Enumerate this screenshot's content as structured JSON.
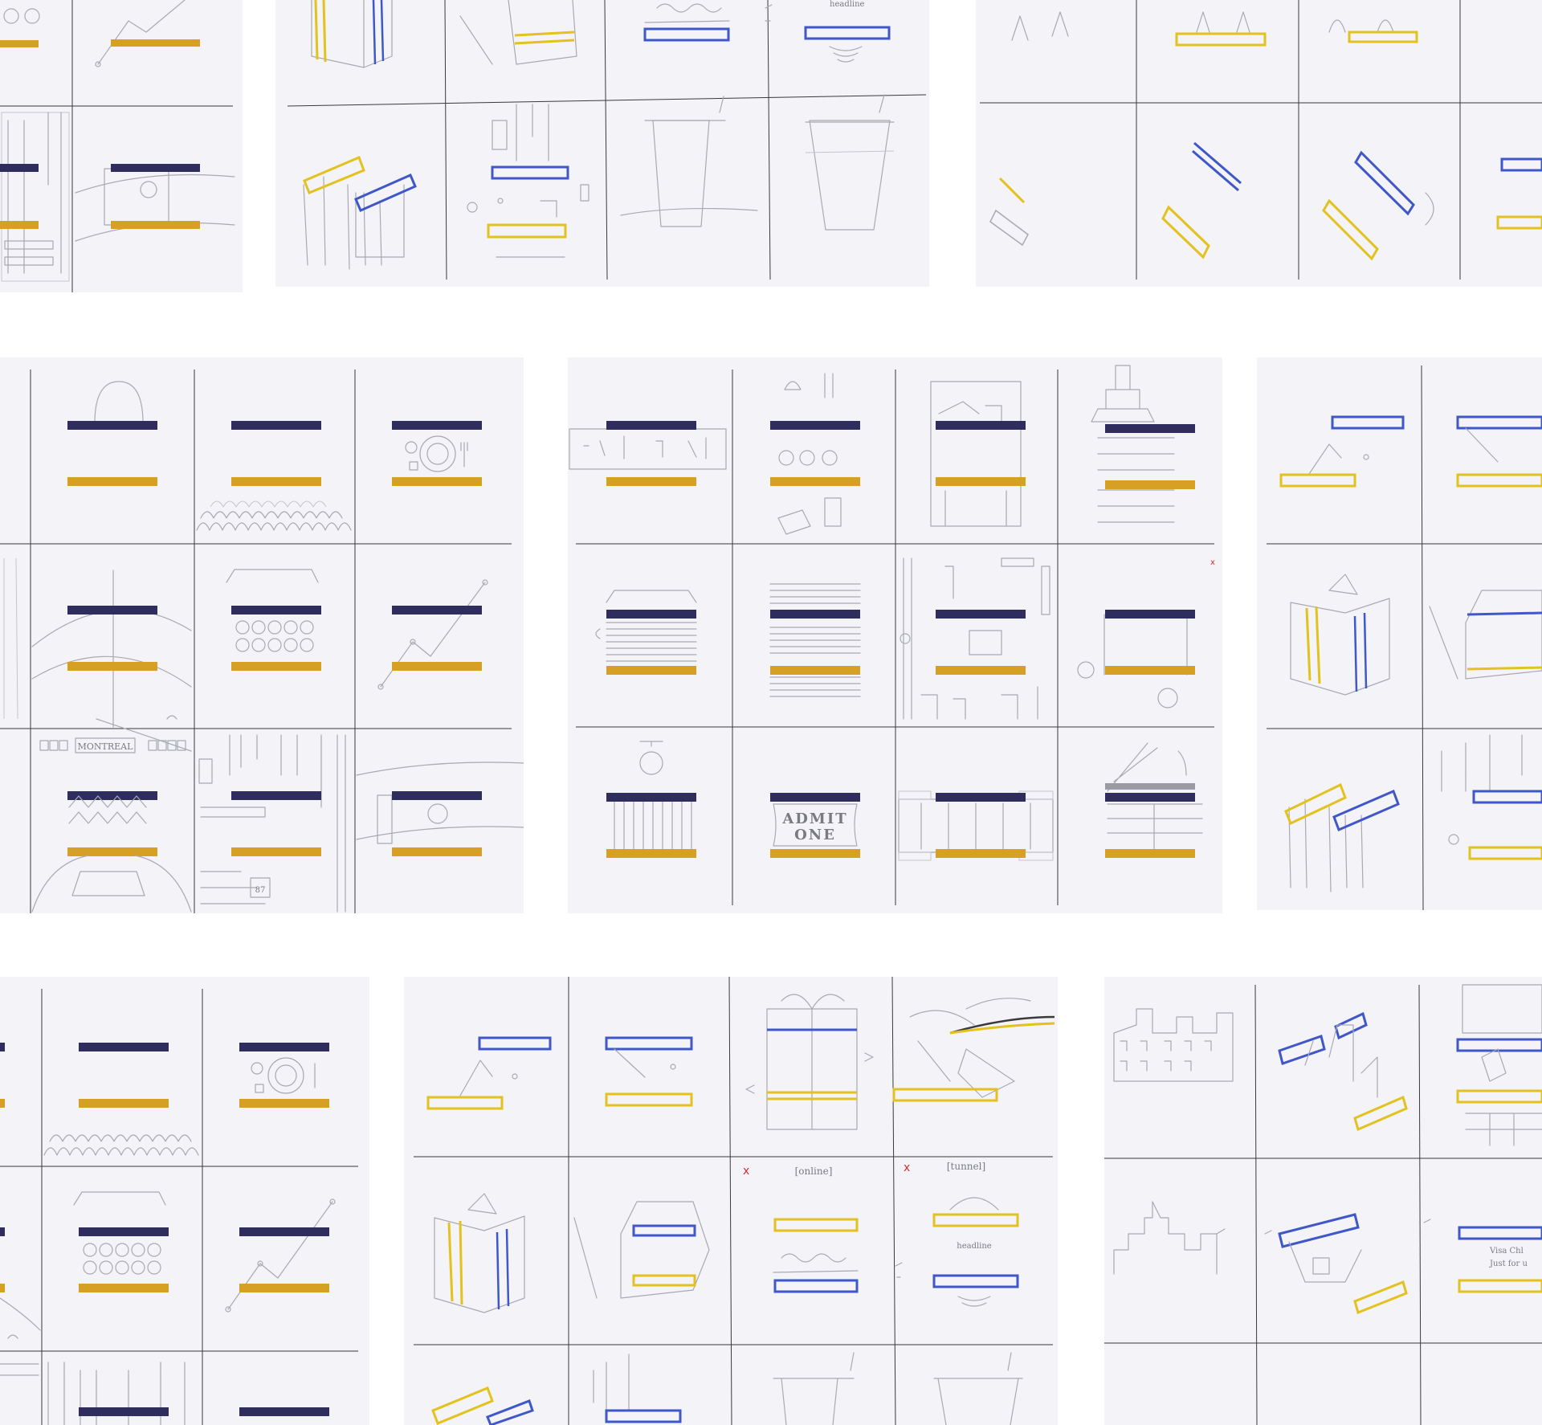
{
  "colors": {
    "navy": "#2f2d5e",
    "mustard": "#d6a024",
    "pencil_blue": "#3f57c8",
    "pencil_yellow": "#e3c21e",
    "paper": "#f3f3f8",
    "grid_line": "#3a3a3a",
    "graphite": "#a9a9b1",
    "red_mark": "#d03030"
  },
  "sketch_text": {
    "montreal": "MONTREAL",
    "admit": "ADMIT",
    "one": "ONE",
    "headline": "headline",
    "online": "[online]",
    "tunnel": "[tunnel]",
    "mark_x": "x",
    "number": "87",
    "visa_line1": "Visa Chl",
    "visa_line2": "Just for u"
  },
  "icons": [
    "shopping-bag-icon",
    "audience-icon",
    "dinner-plate-icon",
    "power-pole-icon",
    "egg-carton-icon",
    "line-graph-icon",
    "city-map-icon",
    "film-strip-icon",
    "gift-box-icon",
    "building-icon",
    "cup-icon",
    "skyscraper-icon",
    "ticket-icon",
    "clapperboard-icon",
    "crib-icon",
    "yarn-icon",
    "fridge-icon",
    "wave-icon",
    "speaker-icon"
  ]
}
